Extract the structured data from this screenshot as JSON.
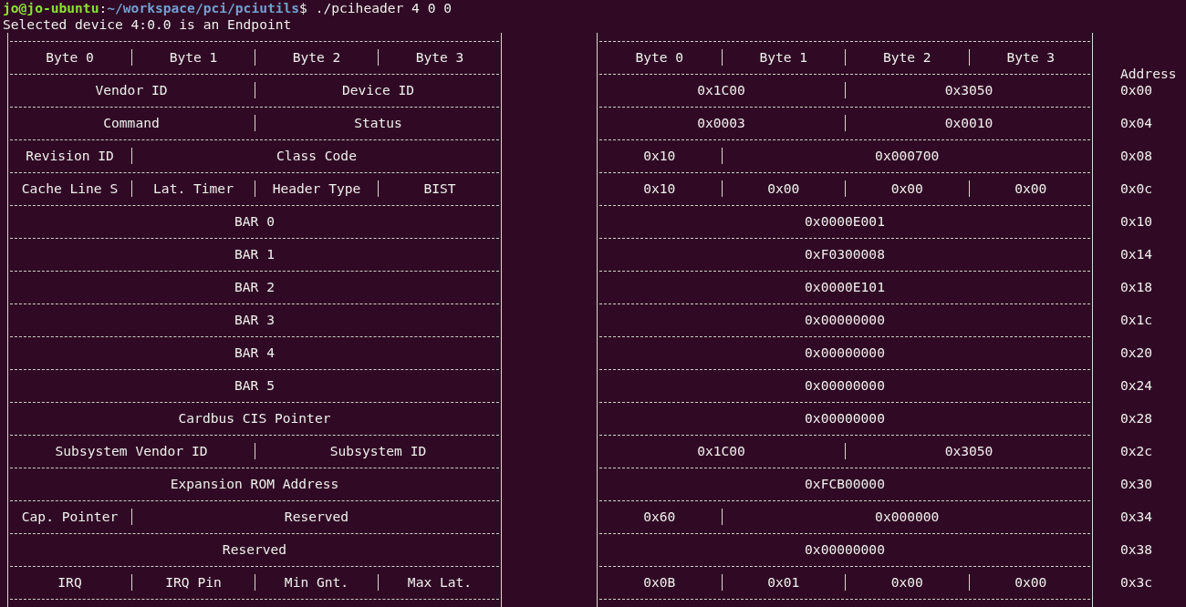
{
  "prompt": {
    "user_host": "jo@jo-ubuntu",
    "separator": ":",
    "path": "~/workspace/pci/pciutils",
    "symbol": "$",
    "command": "./pciheader 4 0 0"
  },
  "output_line": "Selected device 4:0.0 is an Endpoint",
  "left_table": {
    "header": [
      "Byte 0",
      "Byte 1",
      "Byte 2",
      "Byte 3"
    ],
    "rows": [
      [
        {
          "text": "Vendor ID",
          "kind": "word"
        },
        {
          "text": "Device ID",
          "kind": "word"
        }
      ],
      [
        {
          "text": "Command",
          "kind": "word"
        },
        {
          "text": "Status",
          "kind": "word"
        }
      ],
      [
        {
          "text": "Revision ID",
          "kind": "byte"
        },
        {
          "text": "Class Code",
          "kind": "triple"
        }
      ],
      [
        {
          "text": "Cache Line S",
          "kind": "byte"
        },
        {
          "text": "Lat. Timer",
          "kind": "byte"
        },
        {
          "text": "Header Type",
          "kind": "byte"
        },
        {
          "text": "BIST",
          "kind": "byte"
        }
      ],
      [
        {
          "text": "BAR 0",
          "kind": "dword"
        }
      ],
      [
        {
          "text": "BAR 1",
          "kind": "dword"
        }
      ],
      [
        {
          "text": "BAR 2",
          "kind": "dword"
        }
      ],
      [
        {
          "text": "BAR 3",
          "kind": "dword"
        }
      ],
      [
        {
          "text": "BAR 4",
          "kind": "dword"
        }
      ],
      [
        {
          "text": "BAR 5",
          "kind": "dword"
        }
      ],
      [
        {
          "text": "Cardbus CIS Pointer",
          "kind": "dword"
        }
      ],
      [
        {
          "text": "Subsystem Vendor ID",
          "kind": "word"
        },
        {
          "text": "Subsystem ID",
          "kind": "word"
        }
      ],
      [
        {
          "text": "Expansion ROM Address",
          "kind": "dword"
        }
      ],
      [
        {
          "text": "Cap. Pointer",
          "kind": "byte"
        },
        {
          "text": "Reserved",
          "kind": "triple"
        }
      ],
      [
        {
          "text": "Reserved",
          "kind": "dword"
        }
      ],
      [
        {
          "text": "IRQ",
          "kind": "byte"
        },
        {
          "text": "IRQ Pin",
          "kind": "byte"
        },
        {
          "text": "Min Gnt.",
          "kind": "byte"
        },
        {
          "text": "Max Lat.",
          "kind": "byte"
        }
      ]
    ]
  },
  "right_table": {
    "header": [
      "Byte 0",
      "Byte 1",
      "Byte 2",
      "Byte 3"
    ],
    "rows": [
      [
        {
          "text": "0x1C00",
          "kind": "word"
        },
        {
          "text": "0x3050",
          "kind": "word"
        }
      ],
      [
        {
          "text": "0x0003",
          "kind": "word"
        },
        {
          "text": "0x0010",
          "kind": "word"
        }
      ],
      [
        {
          "text": "0x10",
          "kind": "byte"
        },
        {
          "text": "0x000700",
          "kind": "triple"
        }
      ],
      [
        {
          "text": "0x10",
          "kind": "byte"
        },
        {
          "text": "0x00",
          "kind": "byte"
        },
        {
          "text": "0x00",
          "kind": "byte"
        },
        {
          "text": "0x00",
          "kind": "byte"
        }
      ],
      [
        {
          "text": "0x0000E001",
          "kind": "dword"
        }
      ],
      [
        {
          "text": "0xF0300008",
          "kind": "dword"
        }
      ],
      [
        {
          "text": "0x0000E101",
          "kind": "dword"
        }
      ],
      [
        {
          "text": "0x00000000",
          "kind": "dword"
        }
      ],
      [
        {
          "text": "0x00000000",
          "kind": "dword"
        }
      ],
      [
        {
          "text": "0x00000000",
          "kind": "dword"
        }
      ],
      [
        {
          "text": "0x00000000",
          "kind": "dword"
        }
      ],
      [
        {
          "text": "0x1C00",
          "kind": "word"
        },
        {
          "text": "0x3050",
          "kind": "word"
        }
      ],
      [
        {
          "text": "0xFCB00000",
          "kind": "dword"
        }
      ],
      [
        {
          "text": "0x60",
          "kind": "byte"
        },
        {
          "text": "0x000000",
          "kind": "triple"
        }
      ],
      [
        {
          "text": "0x00000000",
          "kind": "dword"
        }
      ],
      [
        {
          "text": "0x0B",
          "kind": "byte"
        },
        {
          "text": "0x01",
          "kind": "byte"
        },
        {
          "text": "0x00",
          "kind": "byte"
        },
        {
          "text": "0x00",
          "kind": "byte"
        }
      ]
    ]
  },
  "address_column": {
    "heading": "Address",
    "values": [
      "0x00",
      "0x04",
      "0x08",
      "0x0c",
      "0x10",
      "0x14",
      "0x18",
      "0x1c",
      "0x20",
      "0x24",
      "0x28",
      "0x2c",
      "0x30",
      "0x34",
      "0x38",
      "0x3c"
    ]
  }
}
